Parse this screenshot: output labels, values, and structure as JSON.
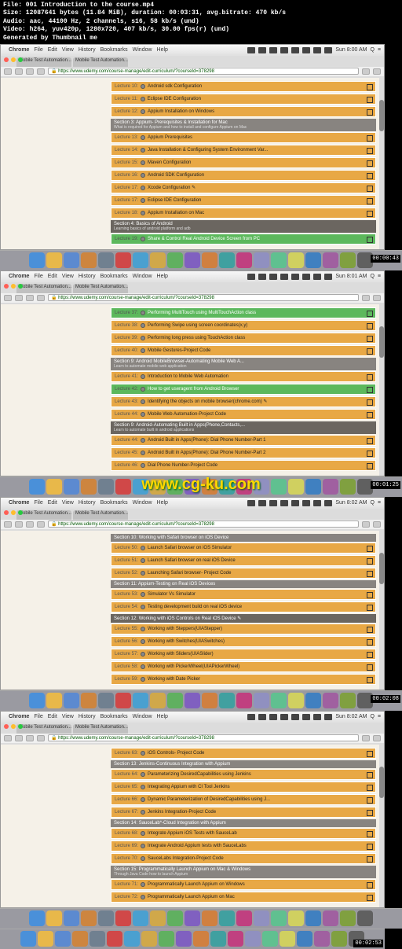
{
  "meta": {
    "file": "File: 001 Introduction to the course.mp4",
    "size": "Size: 12087641 bytes (11.84 MiB), duration: 00:03:31, avg.bitrate: 470 kb/s",
    "audio": "Audio: aac, 44100 Hz, 2 channels, s16, 58 kb/s (und)",
    "video": "Video: h264, yuv420p, 1280x720, 407 kb/s, 30.00 fps(r) (und)",
    "gen": "Generated by Thumbnail me"
  },
  "watermark": "www.cg-ku.com",
  "menubar": {
    "items": [
      "Chrome",
      "File",
      "Edit",
      "View",
      "History",
      "Bookmarks",
      "Window",
      "Help"
    ]
  },
  "tabs": [
    "Mobile Test Automation...",
    "Mobile Test Automation..."
  ],
  "url": "https://www.udemy.com/course-manage/edit-curriculum/?courseId=378298",
  "screens": [
    {
      "time_right": "Sun 8:00 AM",
      "timecode": "",
      "rows": [
        {
          "type": "lec",
          "n": "Lecture 10:",
          "t": "Android sdk Configuration"
        },
        {
          "type": "lec",
          "n": "Lecture 11:",
          "t": "Eclipse IDE Configuration"
        },
        {
          "type": "lec",
          "n": "Lecture 12:",
          "t": "Appium Installation on Windows"
        },
        {
          "type": "sec",
          "t": "Section 3: Appium- Prerequisites & Installation for Mac",
          "sub": "What is required for Appium and how to install and configure Appium on Mac"
        },
        {
          "type": "lec",
          "n": "Lecture 13:",
          "t": "Appium Prerequisites"
        },
        {
          "type": "lec",
          "n": "Lecture 14:",
          "t": "Java Installation & Configuring System Environment Var..."
        },
        {
          "type": "lec",
          "n": "Lecture 15:",
          "t": "Maven Configuration"
        },
        {
          "type": "lec",
          "n": "Lecture 16:",
          "t": "Android SDK Configuration"
        },
        {
          "type": "lec",
          "n": "Lecture 17:",
          "t": "Xcode Configuration ✎",
          "edit": true
        },
        {
          "type": "lec",
          "n": "Lecture 17:",
          "t": "Eclipse IDE Configuration"
        },
        {
          "type": "lec",
          "n": "Lecture 18:",
          "t": "Appium Installation on Mac"
        },
        {
          "type": "sec",
          "t": "Section 4: Basics of Android",
          "sub": "Learning basics of android platform and adb",
          "dark": true
        },
        {
          "type": "lec",
          "n": "Lecture 19:",
          "t": "Share & Control Real Android Device Screen from PC",
          "green": true
        }
      ]
    },
    {
      "time_right": "Sun 8:01 AM",
      "timecode": "00:00:43",
      "rows": [
        {
          "type": "lec",
          "n": "Lecture 37:",
          "t": "Performing MultiTouch using MultiTouchAction class",
          "green": true
        },
        {
          "type": "lec",
          "n": "Lecture 38:",
          "t": "Performing Swipe using screen coordinates(x,y)"
        },
        {
          "type": "lec",
          "n": "Lecture 39:",
          "t": "Performing long press using TouchAction class"
        },
        {
          "type": "lec",
          "n": "Lecture 40:",
          "t": "Mobile Gestures-Project Code"
        },
        {
          "type": "sec",
          "t": "Section 9: Android MobileBrowser-Automating Mobile Web A...",
          "sub": "Learn to automate mobile web application"
        },
        {
          "type": "lec",
          "n": "Lecture 41:",
          "t": "Introduction to Mobile Web Automation"
        },
        {
          "type": "lec",
          "n": "Lecture 42:",
          "t": "How to get useragent from Android Browser",
          "green": true
        },
        {
          "type": "lec",
          "n": "Lecture 43:",
          "t": "Identifying the objects on mobile browser(chrome.com) ✎",
          "edit": true
        },
        {
          "type": "lec",
          "n": "Lecture 44:",
          "t": "Mobile Web Automation-Project Code"
        },
        {
          "type": "sec",
          "t": "Section 9: Android-Automating Built in Apps(Phone,Contacts,...",
          "sub": "Learn to automate built in android applications",
          "dark": true
        },
        {
          "type": "lec",
          "n": "Lecture 44:",
          "t": "Android Built in Apps(Phone): Dial Phone Number-Part 1"
        },
        {
          "type": "lec",
          "n": "Lecture 45:",
          "t": "Android Built in Apps(Phone): Dial Phone Number-Part 2"
        },
        {
          "type": "lec",
          "n": "Lecture 46:",
          "t": "Dial Phone Number-Project Code"
        }
      ]
    },
    {
      "time_right": "Sun 8:02 AM",
      "timecode": "00:01:25",
      "rows": [
        {
          "type": "sec",
          "t": "Section 10: Working with Safari browser on iOS Device",
          "sub": ""
        },
        {
          "type": "lec",
          "n": "Lecture 50:",
          "t": "Launch Safari browser on iOS Simulator"
        },
        {
          "type": "lec",
          "n": "Lecture 51:",
          "t": "Launch Safari browser on real iOS Device"
        },
        {
          "type": "lec",
          "n": "Lecture 52:",
          "t": "Launching Safari browser- Project Code"
        },
        {
          "type": "sec",
          "t": "Section 11: Appium-Testing on Real iOS Devices",
          "sub": ""
        },
        {
          "type": "lec",
          "n": "Lecture 53:",
          "t": "Simulator Vs Simulator"
        },
        {
          "type": "lec",
          "n": "Lecture 54:",
          "t": "Testing development build on real iOS device"
        },
        {
          "type": "sec",
          "t": "Section 12: Working with iOS Controls on Real iOS Device ✎",
          "sub": "",
          "dark": true
        },
        {
          "type": "lec",
          "n": "Lecture 55:",
          "t": "Working with Steppers(UIAStepper)"
        },
        {
          "type": "lec",
          "n": "Lecture 56:",
          "t": "Working with Switches(UIASwitches)"
        },
        {
          "type": "lec",
          "n": "Lecture 57:",
          "t": "Working with Sliders(UIASlider)"
        },
        {
          "type": "lec",
          "n": "Lecture 58:",
          "t": "Working with PickerWheel(UIAPickerWheel)"
        },
        {
          "type": "lec",
          "n": "Lecture 59:",
          "t": "Working with Date Picker"
        }
      ]
    },
    {
      "time_right": "Sun 8:02 AM",
      "timecode": "00:02:08",
      "rows": [
        {
          "type": "lec",
          "n": "Lecture 63:",
          "t": "iOS Controls- Project Code"
        },
        {
          "type": "sec",
          "t": "Section 13: Jenkins-Continuous Integration with Appium",
          "sub": ""
        },
        {
          "type": "lec",
          "n": "Lecture 64:",
          "t": "Parameterizing DesiredCapabilities using Jenkins"
        },
        {
          "type": "lec",
          "n": "Lecture 65:",
          "t": "Integrating Appium with CI Tool Jenkins"
        },
        {
          "type": "lec",
          "n": "Lecture 66:",
          "t": "Dynamic Parameterization of DesiredCapabilities using J..."
        },
        {
          "type": "lec",
          "n": "Lecture 67:",
          "t": "Jenkins Integration-Project Code"
        },
        {
          "type": "sec",
          "t": "Section 14: SauceLab*-Cloud Integration with Appium",
          "sub": ""
        },
        {
          "type": "lec",
          "n": "Lecture 68:",
          "t": "Integrate Appium iOS Tests with SauceLab"
        },
        {
          "type": "lec",
          "n": "Lecture 69:",
          "t": "Integrate Android Appium tests with SauceLabs"
        },
        {
          "type": "lec",
          "n": "Lecture 70:",
          "t": "SauceLabs Integration-Project Code"
        },
        {
          "type": "sec",
          "t": "Section 15: Programmatically Launch Appium on Mac & Windows",
          "sub": "Through Java Code how to launch Appium"
        },
        {
          "type": "lec",
          "n": "Lecture 71:",
          "t": "Programmatically Launch Appium on Windows"
        },
        {
          "type": "lec",
          "n": "Lecture 72:",
          "t": "Programmatically Launch Appium on Mac"
        }
      ]
    }
  ],
  "dock_colors": [
    "#4a90d9",
    "#e8b84a",
    "#5c8ad0",
    "#cd853f",
    "#708090",
    "#d04848",
    "#4aa0d0",
    "#d0a84a",
    "#60b060",
    "#8060c0",
    "#d08040",
    "#40a0a0",
    "#c04080",
    "#9090c0",
    "#60c090",
    "#d0d060",
    "#4080c0",
    "#a060a0",
    "#80a040",
    "#606060"
  ],
  "timecodes_final": "00:02:53"
}
